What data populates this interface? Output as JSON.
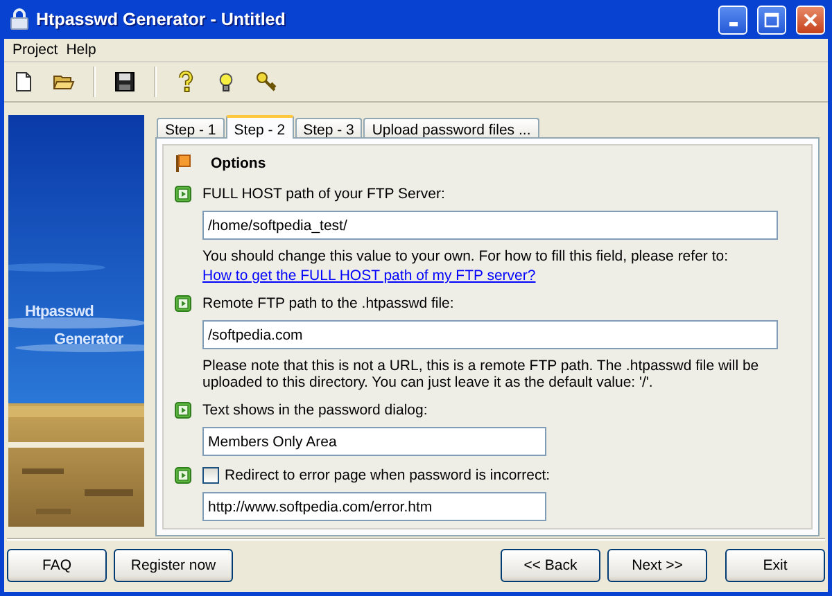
{
  "window": {
    "title": "Htpasswd Generator - Untitled"
  },
  "menu": [
    {
      "label": "Project"
    },
    {
      "label": "Help"
    }
  ],
  "banner": {
    "lines": [
      "Htpasswd",
      "Generator"
    ]
  },
  "tabs": [
    {
      "label": "Step - 1",
      "selected": false
    },
    {
      "label": "Step - 2",
      "selected": true
    },
    {
      "label": "Step - 3",
      "selected": false
    },
    {
      "label": "Upload password files ...",
      "selected": false
    }
  ],
  "section": {
    "title": "Options"
  },
  "options": [
    {
      "kind": "field",
      "label": "FULL HOST path of your FTP Server:",
      "value": "/home/softpedia_test/",
      "note": "You should change this value to your own. For how to fill this field, please refer to:",
      "link": "How to get the FULL HOST path of my FTP server?"
    },
    {
      "kind": "field",
      "label": "Remote FTP path to the .htpasswd file:",
      "value": "/softpedia.com",
      "note": "Please note that this is not a URL, this is a remote FTP path. The .htpasswd file will be uploaded to this directory. You can just leave it as the default value: '/'."
    },
    {
      "kind": "field",
      "label": "Text shows in the password dialog:",
      "value": "Members Only Area"
    },
    {
      "kind": "checkbox",
      "label": "Redirect to error page when password is incorrect:",
      "checked": false,
      "value": "http://www.softpedia.com/error.htm"
    }
  ],
  "left_buttons": [
    {
      "label": "FAQ"
    },
    {
      "label": "Register now"
    }
  ],
  "right_buttons": [
    {
      "label": "<< Back"
    },
    {
      "label": "Next >>"
    },
    {
      "label": "Exit"
    }
  ]
}
